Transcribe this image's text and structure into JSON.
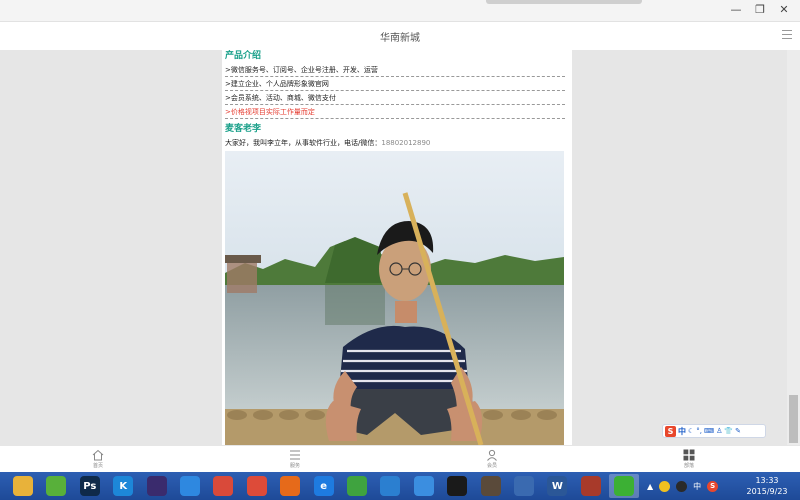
{
  "window": {
    "title": "华南新城",
    "controls": {
      "minimize": "—",
      "restore": "❐",
      "close": "✕"
    }
  },
  "products": {
    "heading": "产品介绍",
    "items": [
      ">微信服务号、订阅号、企业号注册、开发、运营",
      ">建立企业、个人品牌形象微官网",
      ">会员系统、活动、商城、微信支付",
      ">价格视项目实际工作量而定"
    ]
  },
  "about": {
    "heading": "麦客老李",
    "intro": "大家好，我叫李立年，从事软件行业，电话/微信：",
    "phone": "18802012890"
  },
  "bottom_nav": [
    {
      "label": "首页",
      "icon": "home-icon"
    },
    {
      "label": "服务",
      "icon": "list-icon"
    },
    {
      "label": "会员",
      "icon": "user-icon"
    },
    {
      "label": "部落",
      "icon": "grid-icon"
    }
  ],
  "ime": {
    "logo": "S",
    "mode": "中"
  },
  "taskbar": {
    "apps": [
      {
        "name": "file-explorer-icon",
        "letter": "",
        "color": "#e8b23a"
      },
      {
        "name": "green-app-icon",
        "letter": "",
        "color": "#58b03a"
      },
      {
        "name": "photoshop-icon",
        "letter": "Ps",
        "color": "#0f2a4a"
      },
      {
        "name": "kugou-icon",
        "letter": "K",
        "color": "#1d87d8"
      },
      {
        "name": "eclipse-icon",
        "letter": "",
        "color": "#3a2b6d"
      },
      {
        "name": "pen-app-icon",
        "letter": "",
        "color": "#2e88e0"
      },
      {
        "name": "color-app-icon",
        "letter": "",
        "color": "#d94a3a"
      },
      {
        "name": "chrome-icon",
        "letter": "",
        "color": "#dd4b39"
      },
      {
        "name": "firefox-icon",
        "letter": "",
        "color": "#e66a1a"
      },
      {
        "name": "ie-icon",
        "letter": "e",
        "color": "#1e7be0"
      },
      {
        "name": "arrow-app-icon",
        "letter": "",
        "color": "#3fa33f"
      },
      {
        "name": "cloud-app-icon",
        "letter": "",
        "color": "#2b7fd0"
      },
      {
        "name": "network-app-icon",
        "letter": "",
        "color": "#3b8ee0"
      },
      {
        "name": "eye-app-icon",
        "letter": "",
        "color": "#1a1a1a"
      },
      {
        "name": "gear-app-icon",
        "letter": "",
        "color": "#5a4a3a"
      },
      {
        "name": "monitor-app-icon",
        "letter": "",
        "color": "#3a6ab0"
      },
      {
        "name": "word-icon",
        "letter": "W",
        "color": "#2b5797"
      },
      {
        "name": "house-app-icon",
        "letter": "",
        "color": "#a83a2a"
      },
      {
        "name": "wechat-icon",
        "letter": "",
        "color": "#3cb034"
      }
    ],
    "tray_ime": "中",
    "tray_s": "S",
    "time": "13:33",
    "date": "2015/9/23"
  },
  "colors": {
    "accent": "#1aa08a",
    "price_red": "#e53b2f",
    "taskbar": "#2457a8"
  }
}
